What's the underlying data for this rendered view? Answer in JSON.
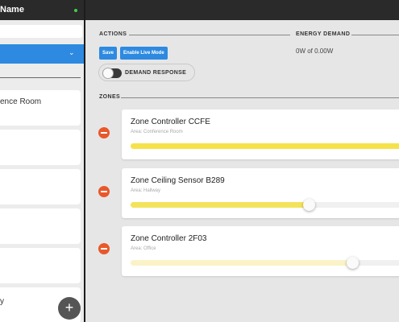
{
  "sidebar": {
    "title": "Name",
    "add_label": "+",
    "items": [
      {
        "label": "ence Room"
      },
      {
        "label": ""
      },
      {
        "label": ""
      },
      {
        "label": ""
      },
      {
        "label": ""
      },
      {
        "label": "y"
      }
    ]
  },
  "actions": {
    "heading": "ACTIONS",
    "save_label": "Save",
    "live_mode_label": "Enable Live Mode",
    "demand_response_label": "DEMAND RESPONSE",
    "demand_response_on": false
  },
  "energy": {
    "heading": "ENERGY DEMAND",
    "value": "0W of 0.00W"
  },
  "zones": {
    "heading": "ZONES",
    "items": [
      {
        "name": "Zone Controller CCFE",
        "area": "Area: Conference Room",
        "level": 1.0,
        "color": "#f5e24a",
        "show_knob": false
      },
      {
        "name": "Zone Ceiling Sensor B289",
        "area": "Area: Hallway",
        "level": 0.65,
        "color": "#f3e35a",
        "show_knob": true
      },
      {
        "name": "Zone Controller 2F03",
        "area": "Area: Office",
        "level": 0.81,
        "color": "#fbf3c7",
        "show_knob": true
      }
    ]
  },
  "colors": {
    "accent": "#2d8ae0",
    "remove": "#e8582b",
    "status_online": "#3fd04a"
  }
}
